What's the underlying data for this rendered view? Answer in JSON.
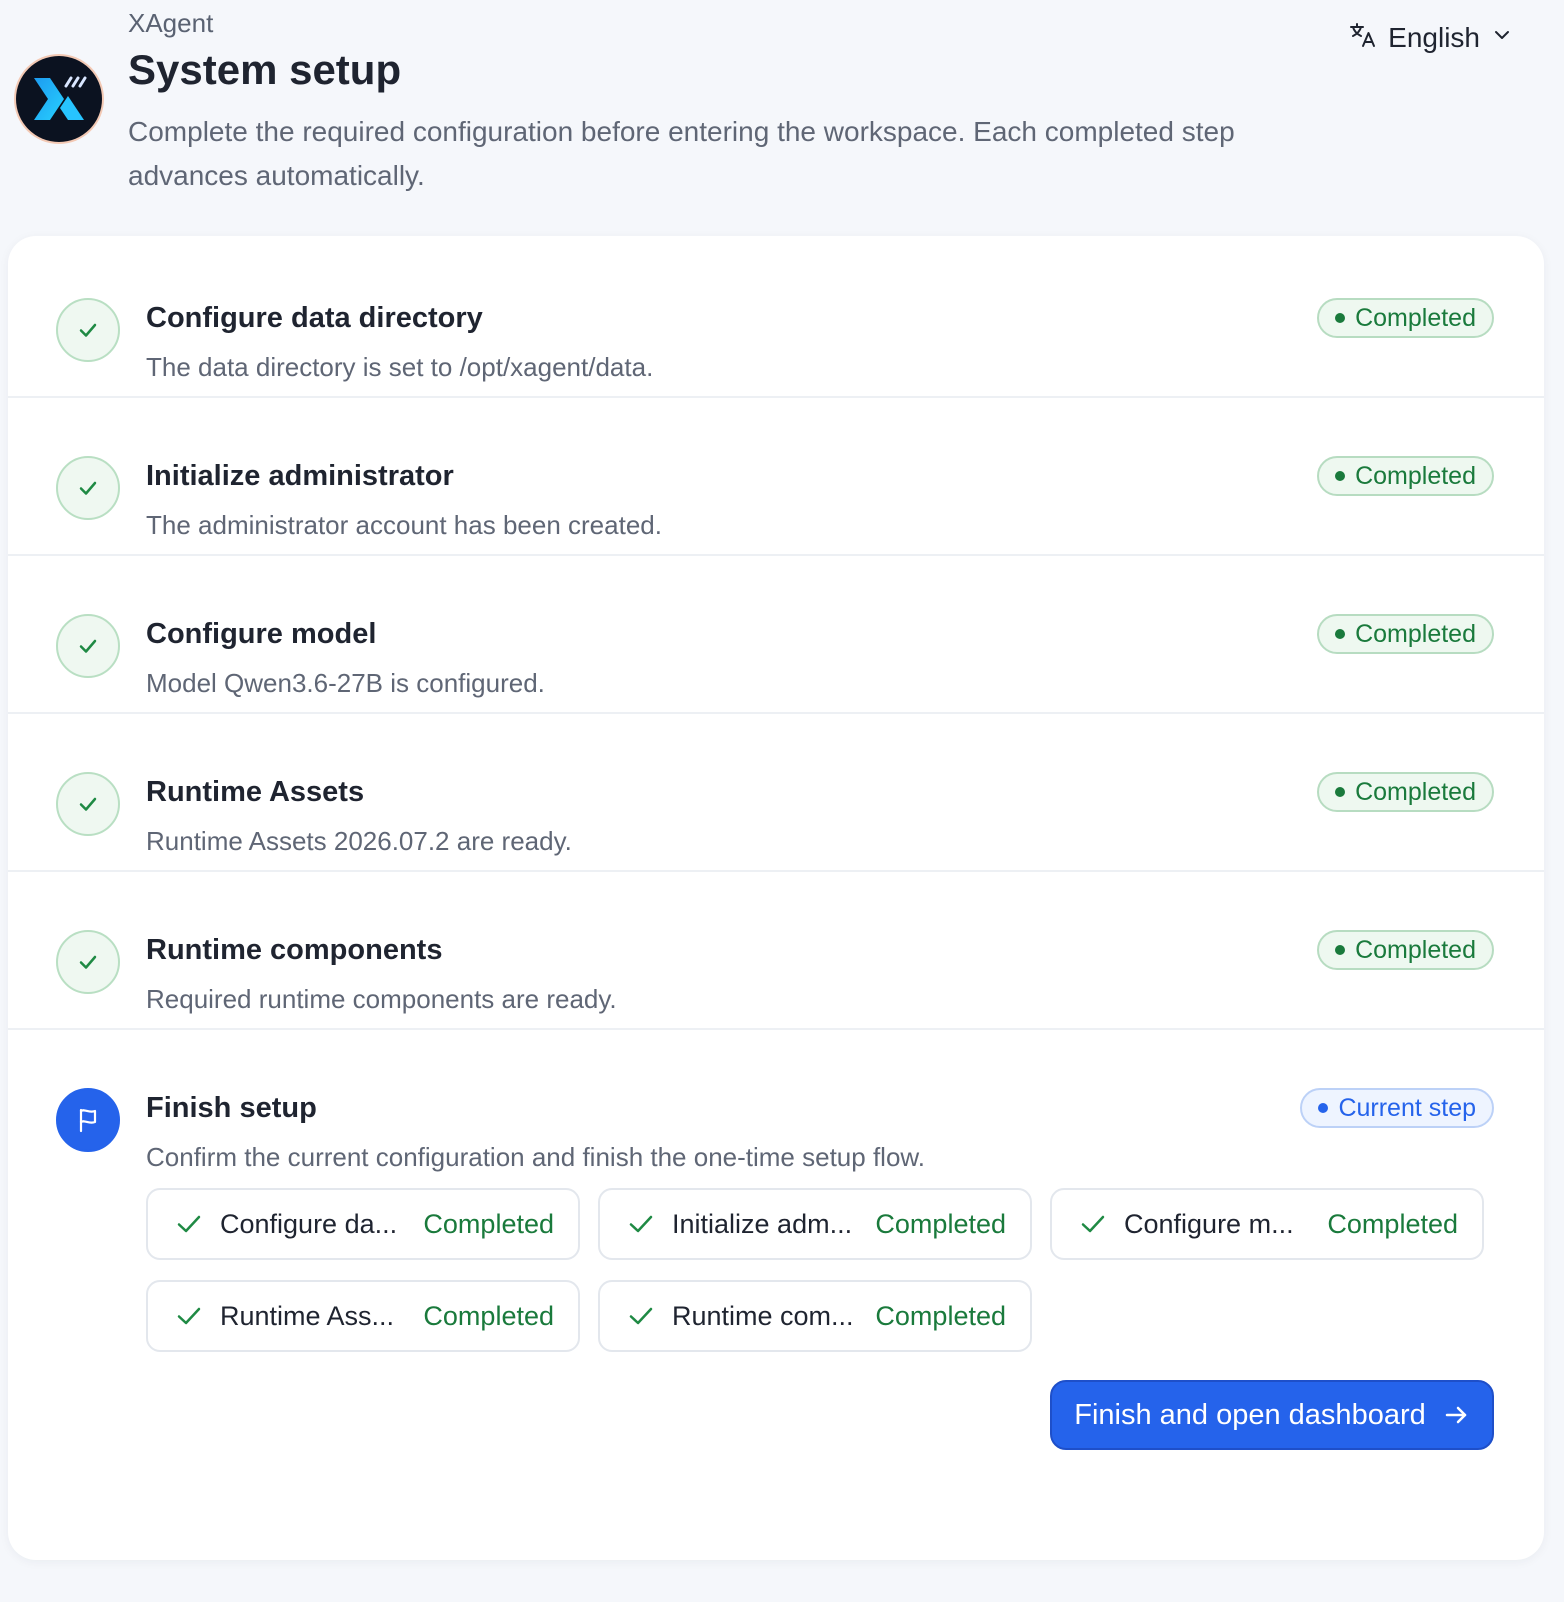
{
  "header": {
    "brand": "XAgent",
    "title": "System setup",
    "subtitle": "Complete the required configuration before entering the workspace. Each completed step advances automatically.",
    "language": "English"
  },
  "steps": [
    {
      "title": "Configure data directory",
      "description": "The data directory is set to /opt/xagent/data.",
      "status": "Completed"
    },
    {
      "title": "Initialize administrator",
      "description": "The administrator account has been created.",
      "status": "Completed"
    },
    {
      "title": "Configure model",
      "description": "Model Qwen3.6-27B is configured.",
      "status": "Completed"
    },
    {
      "title": "Runtime Assets",
      "description": "Runtime Assets 2026.07.2 are ready.",
      "status": "Completed"
    },
    {
      "title": "Runtime components",
      "description": "Required runtime components are ready.",
      "status": "Completed"
    }
  ],
  "finish": {
    "title": "Finish setup",
    "description": "Confirm the current configuration and finish the one-time setup flow.",
    "status": "Current step",
    "summary": [
      {
        "label": "Configure da...",
        "status": "Completed"
      },
      {
        "label": "Initialize adm...",
        "status": "Completed"
      },
      {
        "label": "Configure m...",
        "status": "Completed"
      },
      {
        "label": "Runtime Ass...",
        "status": "Completed"
      },
      {
        "label": "Runtime com...",
        "status": "Completed"
      }
    ],
    "button_label": "Finish and open dashboard"
  },
  "colors": {
    "accent": "#2563eb",
    "success": "#1a7a3c",
    "success_bg": "#eef8f0",
    "background": "#f5f7fb"
  },
  "icons": {
    "logo": "xagent-logo",
    "language": "translate-icon",
    "dropdown": "chevron-down-icon",
    "done": "check-icon",
    "current": "flag-icon",
    "button": "arrow-right-icon"
  }
}
